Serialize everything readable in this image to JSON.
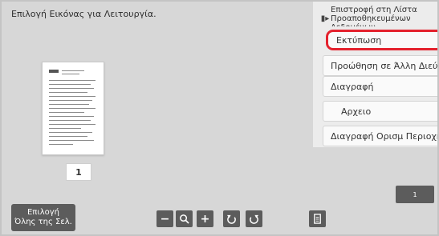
{
  "instruction": "Επιλογή Εικόνας για Λειτουργία.",
  "thumbnail": {
    "page_number": "1"
  },
  "menu": {
    "top_item": "Επιστροφή στη Λίστα Προαποθηκευμένων Δεδομένων",
    "items": [
      {
        "label": "Εκτύπωση",
        "highlighted": true
      },
      {
        "label": "Προώθηση σε Άλλη Διεύθ"
      },
      {
        "label": "Διαγραφή"
      },
      {
        "label": "Αρχειο"
      },
      {
        "label": "Διαγραφή Ορισμ Περιοχής"
      }
    ]
  },
  "bottom": {
    "select_all_line1": "Επιλογή",
    "select_all_line2": "Όλης της Σελ.",
    "count": "1",
    "icons": [
      "zoom-out-icon",
      "zoom-icon",
      "zoom-in-icon",
      "rotate-left-icon",
      "rotate-right-icon",
      "document-icon"
    ]
  },
  "colors": {
    "highlight": "#e4222e",
    "button": "#5c5c5c"
  }
}
